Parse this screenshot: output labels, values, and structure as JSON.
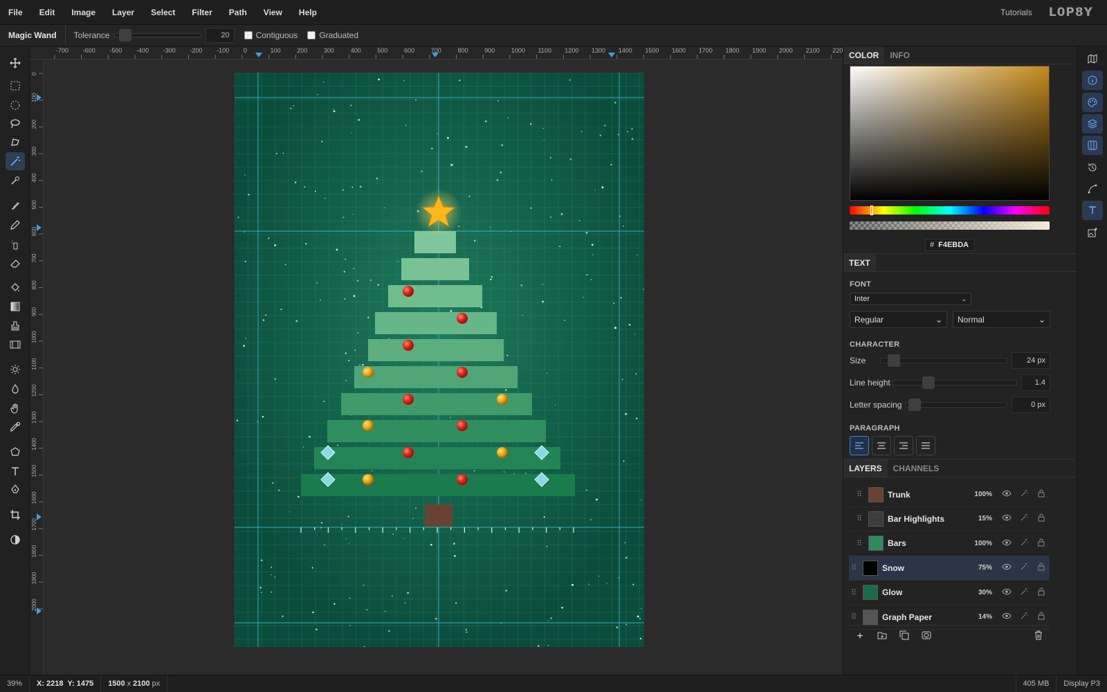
{
  "menubar": {
    "items": [
      "File",
      "Edit",
      "Image",
      "Layer",
      "Select",
      "Filter",
      "Path",
      "View",
      "Help"
    ],
    "tutorials": "Tutorials",
    "logo": "L0P8Y"
  },
  "options": {
    "tool_name": "Magic Wand",
    "tolerance_label": "Tolerance",
    "tolerance_value": "20",
    "contiguous_label": "Contiguous",
    "graduated_label": "Graduated"
  },
  "rulers": {
    "top": [
      "-700",
      "-600",
      "-500",
      "-400",
      "-300",
      "-200",
      "-100",
      "0",
      "100",
      "200",
      "300",
      "400",
      "500",
      "600",
      "700",
      "800",
      "900",
      "1000",
      "1100",
      "1200",
      "1300",
      "1400",
      "1500",
      "1600",
      "1700",
      "1800",
      "1900",
      "2000",
      "2100",
      "2200"
    ],
    "left": [
      "0",
      "100",
      "200",
      "300",
      "400",
      "500",
      "600",
      "700",
      "800",
      "900",
      "1000",
      "1100",
      "1200",
      "1300",
      "1400",
      "1500",
      "1600",
      "1700",
      "1800",
      "1900",
      "2000"
    ]
  },
  "color_panel": {
    "tabs": [
      "COLOR",
      "INFO"
    ],
    "hex_prefix": "#",
    "hex": "F4EBDA",
    "hue_base": "#c48a1c"
  },
  "text_panel": {
    "tab": "TEXT",
    "font_title": "FONT",
    "font": "Inter",
    "style": "Regular",
    "weight": "Normal",
    "character_title": "CHARACTER",
    "size_label": "Size",
    "size_value": "24 px",
    "line_height_label": "Line height",
    "line_height_value": "1.4",
    "letter_spacing_label": "Letter spacing",
    "letter_spacing_value": "0 px",
    "paragraph_title": "PARAGRAPH"
  },
  "layers_panel": {
    "tabs": [
      "LAYERS",
      "CHANNELS"
    ],
    "layers": [
      {
        "name": "Trunk",
        "opacity": "100%"
      },
      {
        "name": "Bar Highlights",
        "opacity": "15%"
      },
      {
        "name": "Bars",
        "opacity": "100%"
      },
      {
        "name": "Snow",
        "opacity": "75%"
      },
      {
        "name": "Glow",
        "opacity": "30%"
      },
      {
        "name": "Graph Paper",
        "opacity": "14%"
      }
    ]
  },
  "status": {
    "zoom": "39%",
    "x_label": "X:",
    "x": "2218",
    "y_label": "Y:",
    "y": "1475",
    "doc_w": "1500",
    "doc_x": "x",
    "doc_h": "2100",
    "doc_unit": "px",
    "memory": "405 MB",
    "profile": "Display P3"
  }
}
